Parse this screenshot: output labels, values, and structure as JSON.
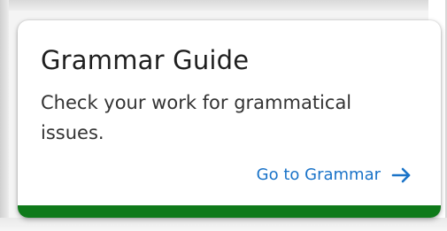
{
  "card": {
    "title": "Grammar Guide",
    "description": "Check your work for grammatical issues.",
    "link_label": "Go to Grammar",
    "link_icon": "arrow-right-icon"
  },
  "colors": {
    "accent_bar": "#0f7a1a",
    "link": "#1a73c8",
    "title": "#1f1f1f",
    "text": "#333333",
    "card_background": "#ffffff"
  }
}
